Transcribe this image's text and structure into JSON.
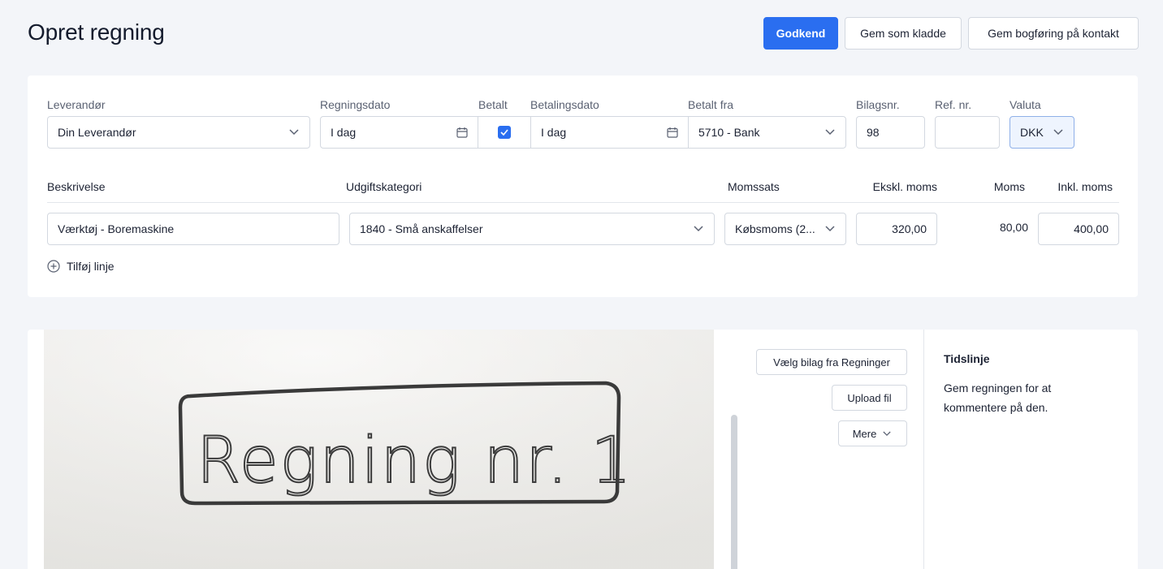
{
  "page": {
    "title": "Opret regning"
  },
  "actions": {
    "approve": "Godkend",
    "save_draft": "Gem som kladde",
    "save_posting": "Gem bogføring på kontakt"
  },
  "form": {
    "supplier": {
      "label": "Leverandør",
      "value": "Din Leverandør"
    },
    "bill_date": {
      "label": "Regningsdato",
      "value": "I dag"
    },
    "paid": {
      "label": "Betalt",
      "checked": true
    },
    "payment_date": {
      "label": "Betalingsdato",
      "value": "I dag"
    },
    "paid_from": {
      "label": "Betalt fra",
      "value": "5710 - Bank"
    },
    "voucher_no": {
      "label": "Bilagsnr.",
      "value": "98"
    },
    "ref_no": {
      "label": "Ref. nr.",
      "value": ""
    },
    "currency": {
      "label": "Valuta",
      "value": "DKK"
    }
  },
  "lines": {
    "headers": {
      "description": "Beskrivelse",
      "category": "Udgiftskategori",
      "vat_rate": "Momssats",
      "excl_vat": "Ekskl. moms",
      "vat": "Moms",
      "incl_vat": "Inkl. moms"
    },
    "rows": [
      {
        "description": "Værktøj - Boremaskine",
        "category": "1840 - Små anskaffelser",
        "vat_rate": "Købsmoms (2...",
        "excl_vat": "320,00",
        "vat": "80,00",
        "incl_vat": "400,00"
      }
    ],
    "add_line": "Tilføj linje"
  },
  "attachment": {
    "handwritten_text": "Regning nr. 1",
    "choose_from_bills": "Vælg bilag fra Regninger",
    "upload": "Upload fil",
    "more": "Mere"
  },
  "timeline": {
    "title": "Tidslinje",
    "text": "Gem regningen for at kommentere på den."
  },
  "colors": {
    "primary": "#2a6ef0",
    "background": "#f3f5f9",
    "border": "#d3d8e0"
  }
}
